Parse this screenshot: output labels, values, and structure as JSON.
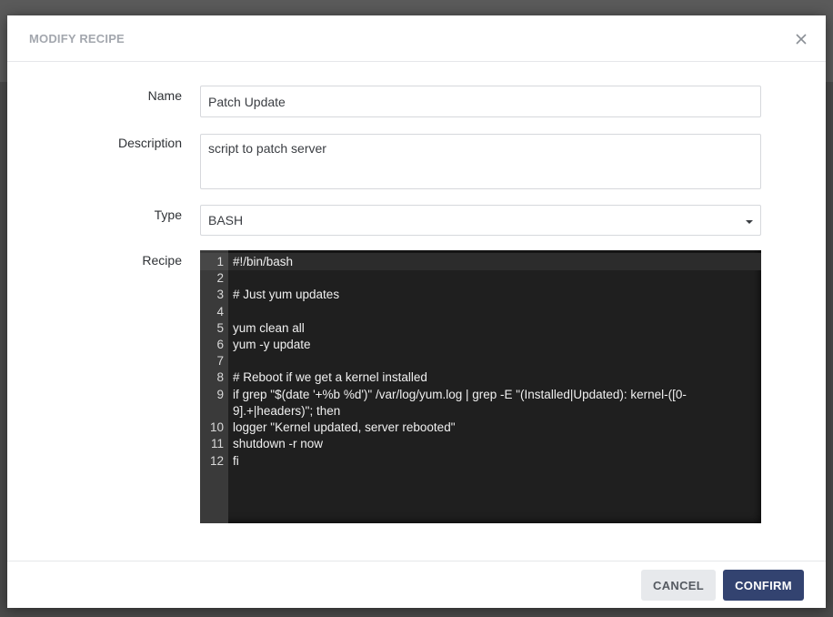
{
  "modal": {
    "title": "MODIFY RECIPE",
    "close_icon": "close-icon"
  },
  "form": {
    "name_label": "Name",
    "name_value": "Patch Update",
    "description_label": "Description",
    "description_value": "script to patch server",
    "type_label": "Type",
    "type_value": "BASH",
    "recipe_label": "Recipe"
  },
  "editor": {
    "lines": [
      {
        "num": "1",
        "code": "#!/bin/bash"
      },
      {
        "num": "2",
        "code": ""
      },
      {
        "num": "3",
        "code": "# Just yum updates"
      },
      {
        "num": "4",
        "code": ""
      },
      {
        "num": "5",
        "code": "yum clean all"
      },
      {
        "num": "6",
        "code": "yum -y update"
      },
      {
        "num": "7",
        "code": ""
      },
      {
        "num": "8",
        "code": "# Reboot if we get a kernel installed"
      },
      {
        "num": "9",
        "code": "if grep \"$(date '+%b %d')\" /var/log/yum.log | grep -E \"(Installed|Updated): kernel-([0-9].+|headers)\"; then"
      },
      {
        "num": "10",
        "code": "logger \"Kernel updated, server rebooted\""
      },
      {
        "num": "11",
        "code": "shutdown -r now"
      },
      {
        "num": "12",
        "code": "fi"
      }
    ]
  },
  "footer": {
    "cancel_label": "CANCEL",
    "confirm_label": "CONFIRM"
  },
  "colors": {
    "confirm_bg": "#334370",
    "cancel_bg": "#e7e9ec",
    "editor_bg": "#1f1f1f"
  }
}
